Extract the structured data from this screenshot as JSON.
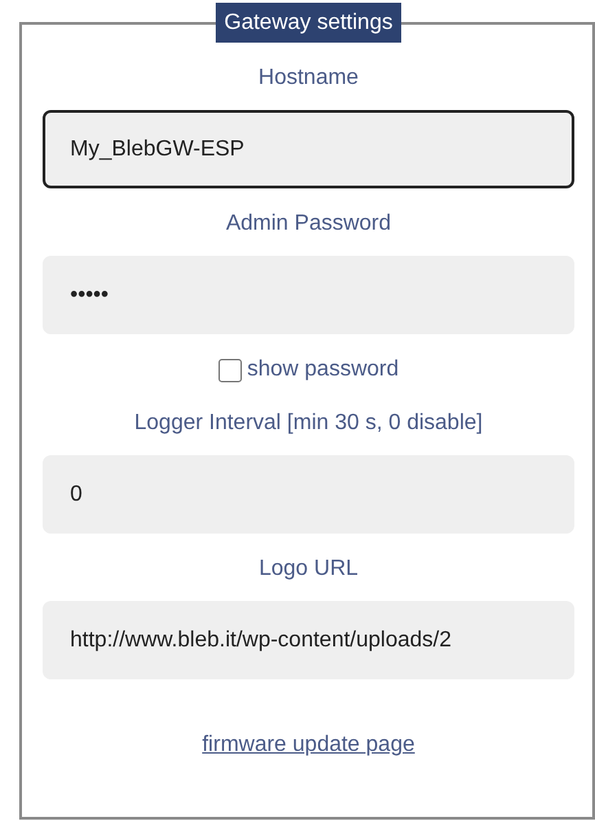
{
  "group": {
    "title": "Gateway settings"
  },
  "items": [
    {
      "kind": "field",
      "label": "Hostname",
      "value": "My_BlebGW-ESP",
      "focused": true
    },
    {
      "kind": "field",
      "label": "Admin Password",
      "value": "•••••",
      "focused": false
    },
    {
      "kind": "checkbox",
      "label": "show password",
      "checked": false
    },
    {
      "kind": "field",
      "label": "Logger Interval [min 30 s, 0 disable]",
      "value": "0",
      "focused": false
    },
    {
      "kind": "field",
      "label": "Logo URL",
      "value": "http://www.bleb.it/wp-content/uploads/2",
      "focused": false
    }
  ],
  "link": "firmware update page"
}
